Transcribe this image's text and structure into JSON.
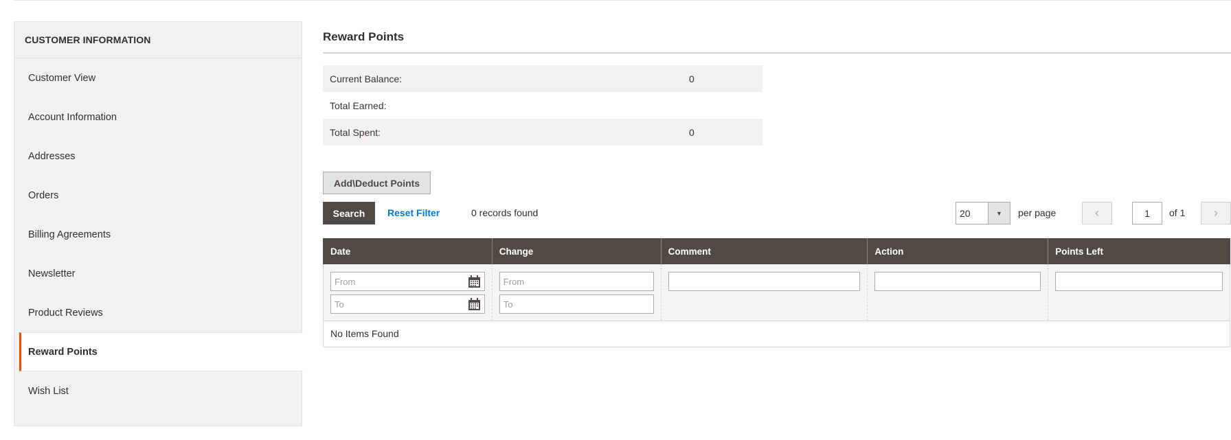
{
  "sidebar": {
    "title": "CUSTOMER INFORMATION",
    "items": [
      {
        "label": "Customer View",
        "active": false
      },
      {
        "label": "Account Information",
        "active": false
      },
      {
        "label": "Addresses",
        "active": false
      },
      {
        "label": "Orders",
        "active": false
      },
      {
        "label": "Billing Agreements",
        "active": false
      },
      {
        "label": "Newsletter",
        "active": false
      },
      {
        "label": "Product Reviews",
        "active": false
      },
      {
        "label": "Reward Points",
        "active": true
      },
      {
        "label": "Wish List",
        "active": false
      }
    ]
  },
  "main": {
    "title": "Reward Points",
    "summary": [
      {
        "label": "Current Balance:",
        "value": "0"
      },
      {
        "label": "Total Earned:",
        "value": ""
      },
      {
        "label": "Total Spent:",
        "value": "0"
      }
    ],
    "add_deduct_label": "Add\\Deduct Points",
    "search_label": "Search",
    "reset_filter_label": "Reset Filter",
    "records_found": "0 records found",
    "pager": {
      "per_page_value": "20",
      "per_page_label": "per page",
      "prev_icon": "‹",
      "next_icon": "›",
      "current_page": "1",
      "of_label": "of 1"
    },
    "grid": {
      "columns": [
        "Date",
        "Change",
        "Comment",
        "Action",
        "Points Left"
      ],
      "filters": {
        "date_from_placeholder": "From",
        "date_to_placeholder": "To",
        "change_from_placeholder": "From",
        "change_to_placeholder": "To",
        "comment_value": "",
        "action_value": "",
        "points_left_value": ""
      },
      "empty_message": "No Items Found"
    }
  },
  "colors": {
    "accent": "#eb5202",
    "header_bg": "#514943",
    "link": "#007bdb"
  }
}
